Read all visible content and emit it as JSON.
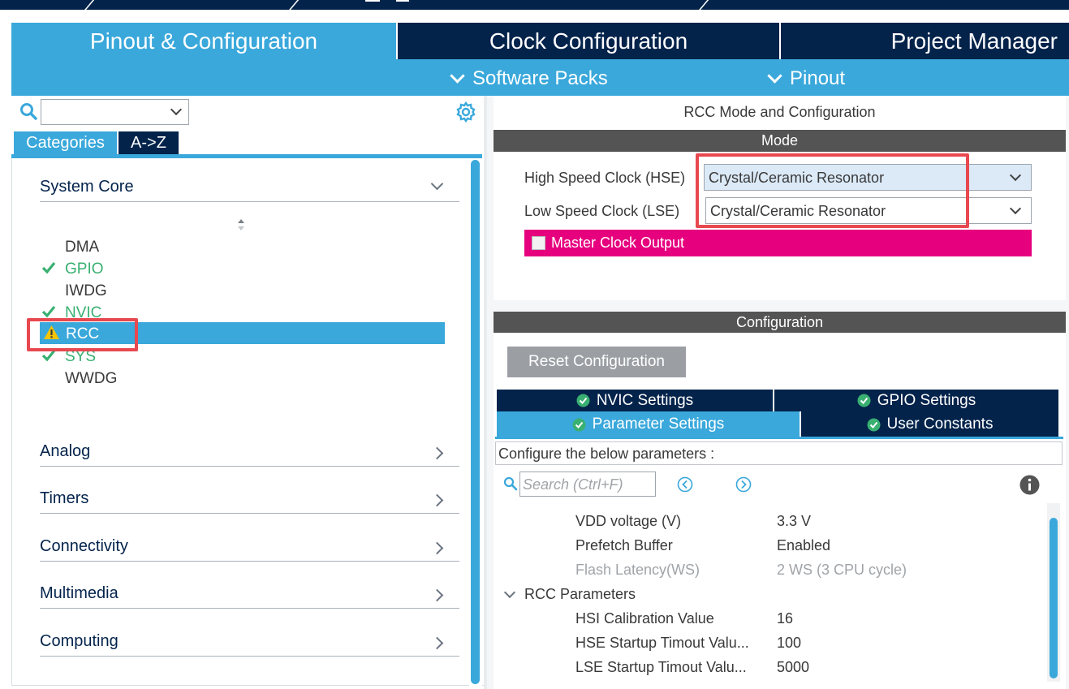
{
  "tabs": {
    "pinout": "Pinout & Configuration",
    "clock": "Clock Configuration",
    "project": "Project Manager"
  },
  "subbar": {
    "software_packs": "Software Packs",
    "pinout": "Pinout"
  },
  "left": {
    "search_value": "",
    "tab_categories": "Categories",
    "tab_az": "A->Z",
    "system_core": "System Core",
    "peripherals": [
      {
        "label": "DMA",
        "status": "none"
      },
      {
        "label": "GPIO",
        "status": "ok"
      },
      {
        "label": "IWDG",
        "status": "none"
      },
      {
        "label": "NVIC",
        "status": "ok"
      },
      {
        "label": "RCC",
        "status": "warning",
        "selected": true
      },
      {
        "label": "SYS",
        "status": "ok"
      },
      {
        "label": "WWDG",
        "status": "none"
      }
    ],
    "sections": [
      "Analog",
      "Timers",
      "Connectivity",
      "Multimedia",
      "Computing"
    ]
  },
  "right": {
    "title": "RCC Mode and Configuration",
    "mode_bar": "Mode",
    "hse_label": "High Speed Clock (HSE)",
    "hse_value": "Crystal/Ceramic Resonator",
    "lse_label": "Low Speed Clock (LSE)",
    "lse_value": "Crystal/Ceramic Resonator",
    "mco_label": "Master Clock Output",
    "mco_checked": false,
    "config_bar": "Configuration",
    "reset_button": "Reset Configuration",
    "config_tabs": {
      "nvic": "NVIC Settings",
      "gpio": "GPIO Settings",
      "param": "Parameter Settings",
      "user": "User Constants"
    },
    "config_desc": "Configure the below parameters :",
    "search_placeholder": "Search (Ctrl+F)",
    "params": [
      {
        "name": "VDD voltage (V)",
        "value": "3.3 V"
      },
      {
        "name": "Prefetch Buffer",
        "value": "Enabled"
      },
      {
        "name": "Flash Latency(WS)",
        "value": "2 WS (3 CPU cycle)",
        "disabled": true
      }
    ],
    "group_rcc": "RCC Parameters",
    "rcc_params": [
      {
        "name": "HSI Calibration Value",
        "value": "16"
      },
      {
        "name": "HSE Startup Timout Valu...",
        "value": "100"
      },
      {
        "name": "LSE Startup Timout Valu...",
        "value": "5000"
      }
    ]
  },
  "colors": {
    "accent_blue": "#3aa8db",
    "navy": "#03234b",
    "ok_green": "#39b071",
    "warning_yellow": "#f5c400",
    "mco_magenta": "#e6007e",
    "highlight_red": "#e8484f"
  }
}
